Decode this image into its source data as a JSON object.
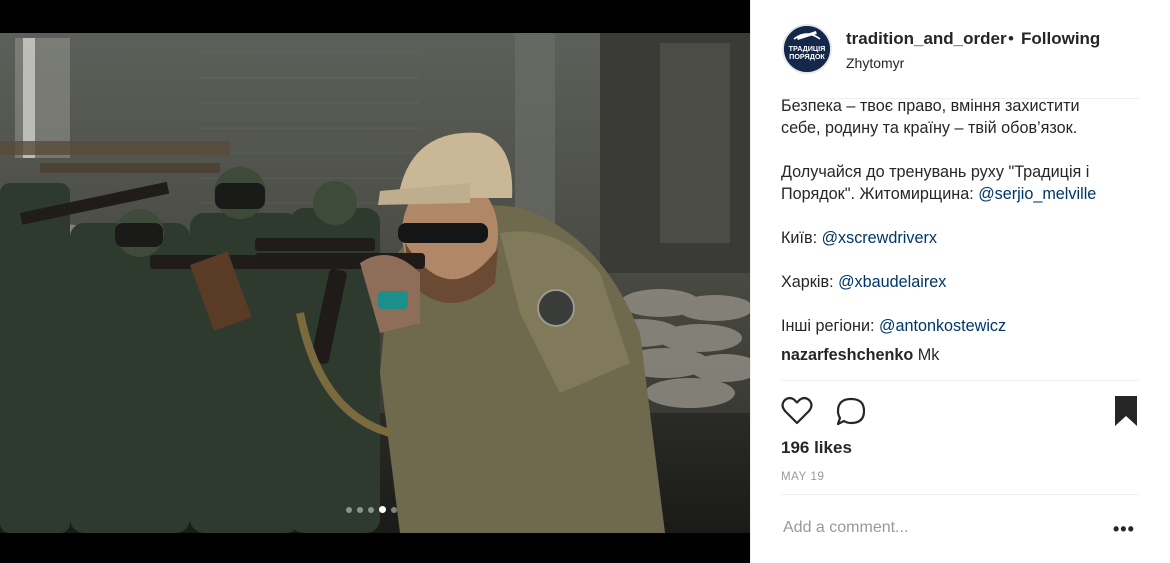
{
  "post": {
    "username": "tradition_and_order",
    "separator": "•",
    "follow_status": "Following",
    "location": "Zhytomyr",
    "avatar_text_line1": "ТРАДИЦІЯ",
    "avatar_text_line2": "ПОРЯДОК"
  },
  "caption": {
    "line1": "Безпека – твоє право, вміння захистити",
    "line2": "себе, родину та країну – твій обов’язок.",
    "line3": "Долучайся до тренувань руху \"Традиція і",
    "line4_text": "Порядок\". Житомирщина: ",
    "line4_link": "@serjio_melville",
    "kyiv_label": "Київ: ",
    "kyiv_link": "@xscrewdriverx",
    "kharkiv_label": "Харків: ",
    "kharkiv_link": "@xbaudelairex",
    "other_label": "Інші регіони: ",
    "other_link": "@antonkostewicz"
  },
  "comment": {
    "author": "nazarfeshchenko",
    "text": " Mk"
  },
  "actions": {
    "like_icon": "heart-icon",
    "comment_icon": "comment-icon",
    "save_icon": "bookmark-icon"
  },
  "stats": {
    "likes": "196 likes",
    "date": "MAY 19"
  },
  "comment_box": {
    "placeholder": "Add a comment...",
    "more": "•••"
  },
  "carousel": {
    "count": 5,
    "active_index": 3
  },
  "colors": {
    "link": "#003569",
    "text": "#262626",
    "muted": "#999999"
  }
}
